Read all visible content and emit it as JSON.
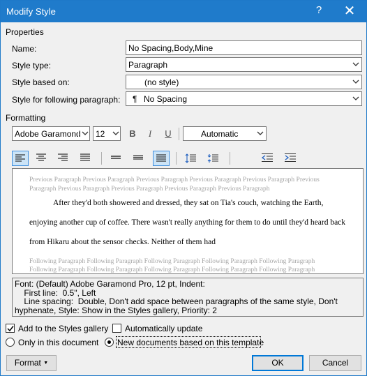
{
  "window": {
    "title": "Modify Style",
    "help_glyph": "?",
    "close_glyph": "✕"
  },
  "properties": {
    "section_label": "Properties",
    "name_label": "Name:",
    "name_value": "No Spacing,Body,Mine",
    "style_type_label": "Style type:",
    "style_type_value": "Paragraph",
    "based_on_label": "Style based on:",
    "based_on_value": "(no style)",
    "following_label": "Style for following paragraph:",
    "following_glyph": "¶",
    "following_value": "No Spacing"
  },
  "formatting": {
    "section_label": "Formatting",
    "font_value": "Adobe Garamond",
    "size_value": "12",
    "bold_label": "B",
    "italic_label": "I",
    "underline_label": "U",
    "color_value": "Automatic"
  },
  "preview": {
    "previous_line1": "Previous Paragraph Previous Paragraph Previous Paragraph Previous Paragraph Previous Paragraph Previous",
    "previous_line2": "Paragraph Previous Paragraph Previous Paragraph Previous Paragraph Previous Paragraph",
    "body_line1": "After they'd both showered and dressed, they sat on Tia's couch, watching the Earth,",
    "body_line2": "enjoying another cup of coffee. There wasn't really anything for them to do until they'd heard back",
    "body_line3": "from Hikaru about the sensor checks. Neither of them had",
    "following_line1": "Following Paragraph Following Paragraph Following Paragraph Following Paragraph Following Paragraph",
    "following_line2": "Following Paragraph Following Paragraph Following Paragraph Following Paragraph Following Paragraph"
  },
  "description": {
    "line1": "Font: (Default) Adobe Garamond Pro, 12 pt, Indent:",
    "line2": "    First line:  0.5\", Left",
    "line3": "    Line spacing:  Double, Don't add space between paragraphs of the same style, Don't",
    "line4": "hyphenate, Style: Show in the Styles gallery, Priority: 2"
  },
  "options": {
    "add_to_gallery_label": "Add to the Styles gallery",
    "add_to_gallery_checked": true,
    "auto_update_label": "Automatically update",
    "auto_update_checked": false,
    "only_doc_label": "Only in this document",
    "template_label": "New documents based on this template",
    "selected_scope": "template"
  },
  "buttons": {
    "format_label": "Format",
    "ok_label": "OK",
    "cancel_label": "Cancel"
  }
}
